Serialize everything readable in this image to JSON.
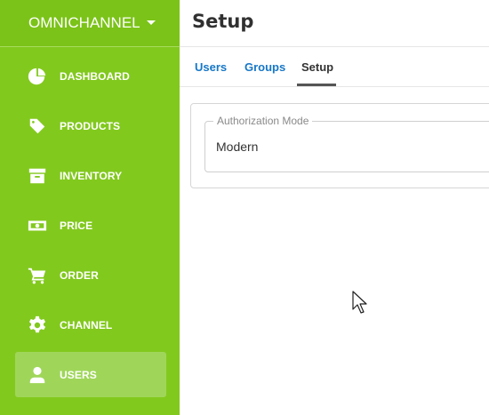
{
  "sidebar": {
    "brand": "OMNICHANNEL",
    "items": [
      {
        "label": "DASHBOARD",
        "icon": "pie-chart-icon",
        "active": false
      },
      {
        "label": "PRODUCTS",
        "icon": "tag-icon",
        "active": false
      },
      {
        "label": "INVENTORY",
        "icon": "archive-box-icon",
        "active": false
      },
      {
        "label": "PRICE",
        "icon": "money-bill-icon",
        "active": false
      },
      {
        "label": "ORDER",
        "icon": "shopping-cart-icon",
        "active": false
      },
      {
        "label": "CHANNEL",
        "icon": "gear-icon",
        "active": false
      },
      {
        "label": "USERS",
        "icon": "user-icon",
        "active": true
      }
    ]
  },
  "main": {
    "title": "Setup",
    "tabs": [
      {
        "label": "Users",
        "active": false
      },
      {
        "label": "Groups",
        "active": false
      },
      {
        "label": "Setup",
        "active": true
      }
    ],
    "authorization": {
      "legend": "Authorization Mode",
      "value": "Modern"
    }
  },
  "colors": {
    "sidebar": "#82c91e",
    "active_item": "#9fd65a",
    "tab_link": "#1677c7"
  }
}
